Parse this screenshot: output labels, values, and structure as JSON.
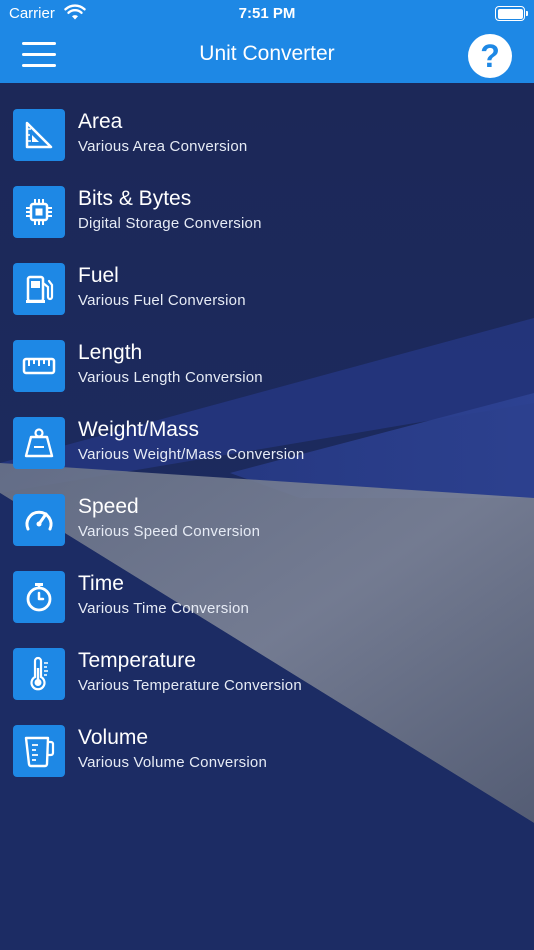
{
  "status": {
    "carrier": "Carrier",
    "time": "7:51 PM"
  },
  "header": {
    "title": "Unit Converter",
    "help_label": "?"
  },
  "colors": {
    "accent": "#1e88e5",
    "background": "#1b2a5e"
  },
  "items": [
    {
      "title": "Area",
      "subtitle": "Various Area Conversion",
      "icon": "set-square-icon"
    },
    {
      "title": "Bits & Bytes",
      "subtitle": "Digital Storage Conversion",
      "icon": "chip-icon"
    },
    {
      "title": "Fuel",
      "subtitle": "Various Fuel Conversion",
      "icon": "fuel-pump-icon"
    },
    {
      "title": "Length",
      "subtitle": "Various Length Conversion",
      "icon": "ruler-icon"
    },
    {
      "title": "Weight/Mass",
      "subtitle": "Various Weight/Mass Conversion",
      "icon": "weight-icon"
    },
    {
      "title": "Speed",
      "subtitle": "Various Speed Conversion",
      "icon": "speedometer-icon"
    },
    {
      "title": "Time",
      "subtitle": "Various Time Conversion",
      "icon": "stopwatch-icon"
    },
    {
      "title": "Temperature",
      "subtitle": "Various Temperature Conversion",
      "icon": "thermometer-icon"
    },
    {
      "title": "Volume",
      "subtitle": "Various Volume Conversion",
      "icon": "measuring-cup-icon"
    }
  ]
}
